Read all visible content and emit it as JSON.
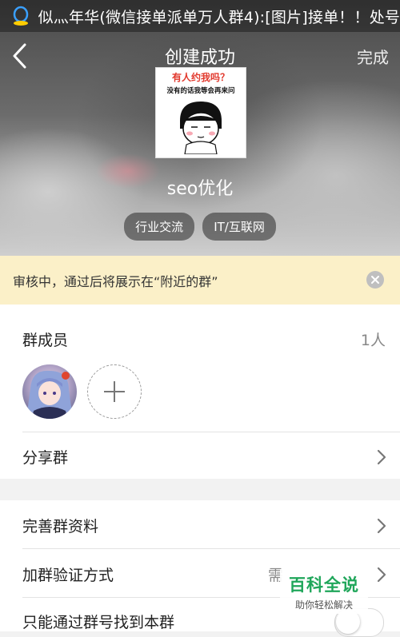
{
  "status_bar": {
    "notification_text": "似灬年华(微信接单派单万人群4):[图片]接单！！处号-"
  },
  "title_bar": {
    "title": "创建成功",
    "done_label": "完成"
  },
  "group": {
    "avatar_caption_line1": "有人约我吗？",
    "avatar_caption_line2": "没有的话我等会再来问",
    "name": "seo优化",
    "tags": [
      "行业交流",
      "IT/互联网"
    ]
  },
  "notice": {
    "text": "审核中，通过后将展示在“附近的群”"
  },
  "members": {
    "label": "群成员",
    "count": "1人"
  },
  "rows": {
    "share": "分享群",
    "complete_info": "完善群资料",
    "join_verify": "加群验证方式",
    "join_verify_value": "需",
    "only_by_number": "只能通过群号找到本群"
  },
  "watermark": {
    "title": "百科全说",
    "subtitle": "助你轻松解决"
  },
  "colors": {
    "notice_bg": "#fbf0c8",
    "watermark_green": "#1fa65a"
  }
}
